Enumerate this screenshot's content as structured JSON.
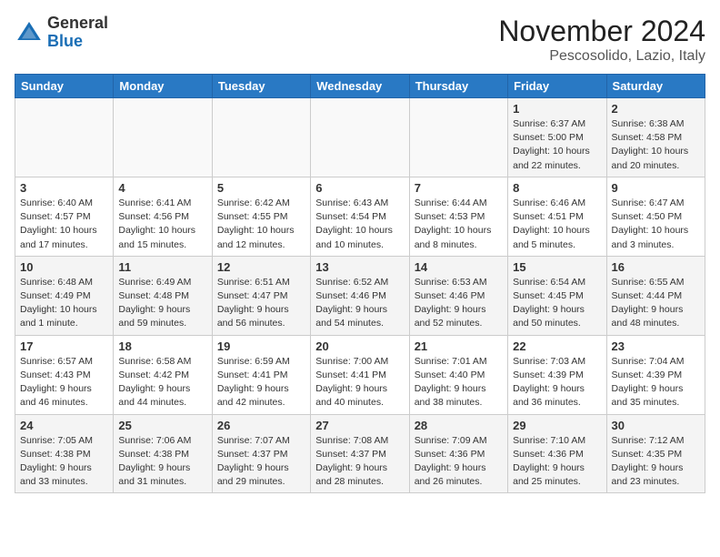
{
  "header": {
    "logo_general": "General",
    "logo_blue": "Blue",
    "month_title": "November 2024",
    "location": "Pescosolido, Lazio, Italy"
  },
  "weekdays": [
    "Sunday",
    "Monday",
    "Tuesday",
    "Wednesday",
    "Thursday",
    "Friday",
    "Saturday"
  ],
  "weeks": [
    [
      {
        "day": "",
        "info": ""
      },
      {
        "day": "",
        "info": ""
      },
      {
        "day": "",
        "info": ""
      },
      {
        "day": "",
        "info": ""
      },
      {
        "day": "",
        "info": ""
      },
      {
        "day": "1",
        "info": "Sunrise: 6:37 AM\nSunset: 5:00 PM\nDaylight: 10 hours and 22 minutes."
      },
      {
        "day": "2",
        "info": "Sunrise: 6:38 AM\nSunset: 4:58 PM\nDaylight: 10 hours and 20 minutes."
      }
    ],
    [
      {
        "day": "3",
        "info": "Sunrise: 6:40 AM\nSunset: 4:57 PM\nDaylight: 10 hours and 17 minutes."
      },
      {
        "day": "4",
        "info": "Sunrise: 6:41 AM\nSunset: 4:56 PM\nDaylight: 10 hours and 15 minutes."
      },
      {
        "day": "5",
        "info": "Sunrise: 6:42 AM\nSunset: 4:55 PM\nDaylight: 10 hours and 12 minutes."
      },
      {
        "day": "6",
        "info": "Sunrise: 6:43 AM\nSunset: 4:54 PM\nDaylight: 10 hours and 10 minutes."
      },
      {
        "day": "7",
        "info": "Sunrise: 6:44 AM\nSunset: 4:53 PM\nDaylight: 10 hours and 8 minutes."
      },
      {
        "day": "8",
        "info": "Sunrise: 6:46 AM\nSunset: 4:51 PM\nDaylight: 10 hours and 5 minutes."
      },
      {
        "day": "9",
        "info": "Sunrise: 6:47 AM\nSunset: 4:50 PM\nDaylight: 10 hours and 3 minutes."
      }
    ],
    [
      {
        "day": "10",
        "info": "Sunrise: 6:48 AM\nSunset: 4:49 PM\nDaylight: 10 hours and 1 minute."
      },
      {
        "day": "11",
        "info": "Sunrise: 6:49 AM\nSunset: 4:48 PM\nDaylight: 9 hours and 59 minutes."
      },
      {
        "day": "12",
        "info": "Sunrise: 6:51 AM\nSunset: 4:47 PM\nDaylight: 9 hours and 56 minutes."
      },
      {
        "day": "13",
        "info": "Sunrise: 6:52 AM\nSunset: 4:46 PM\nDaylight: 9 hours and 54 minutes."
      },
      {
        "day": "14",
        "info": "Sunrise: 6:53 AM\nSunset: 4:46 PM\nDaylight: 9 hours and 52 minutes."
      },
      {
        "day": "15",
        "info": "Sunrise: 6:54 AM\nSunset: 4:45 PM\nDaylight: 9 hours and 50 minutes."
      },
      {
        "day": "16",
        "info": "Sunrise: 6:55 AM\nSunset: 4:44 PM\nDaylight: 9 hours and 48 minutes."
      }
    ],
    [
      {
        "day": "17",
        "info": "Sunrise: 6:57 AM\nSunset: 4:43 PM\nDaylight: 9 hours and 46 minutes."
      },
      {
        "day": "18",
        "info": "Sunrise: 6:58 AM\nSunset: 4:42 PM\nDaylight: 9 hours and 44 minutes."
      },
      {
        "day": "19",
        "info": "Sunrise: 6:59 AM\nSunset: 4:41 PM\nDaylight: 9 hours and 42 minutes."
      },
      {
        "day": "20",
        "info": "Sunrise: 7:00 AM\nSunset: 4:41 PM\nDaylight: 9 hours and 40 minutes."
      },
      {
        "day": "21",
        "info": "Sunrise: 7:01 AM\nSunset: 4:40 PM\nDaylight: 9 hours and 38 minutes."
      },
      {
        "day": "22",
        "info": "Sunrise: 7:03 AM\nSunset: 4:39 PM\nDaylight: 9 hours and 36 minutes."
      },
      {
        "day": "23",
        "info": "Sunrise: 7:04 AM\nSunset: 4:39 PM\nDaylight: 9 hours and 35 minutes."
      }
    ],
    [
      {
        "day": "24",
        "info": "Sunrise: 7:05 AM\nSunset: 4:38 PM\nDaylight: 9 hours and 33 minutes."
      },
      {
        "day": "25",
        "info": "Sunrise: 7:06 AM\nSunset: 4:38 PM\nDaylight: 9 hours and 31 minutes."
      },
      {
        "day": "26",
        "info": "Sunrise: 7:07 AM\nSunset: 4:37 PM\nDaylight: 9 hours and 29 minutes."
      },
      {
        "day": "27",
        "info": "Sunrise: 7:08 AM\nSunset: 4:37 PM\nDaylight: 9 hours and 28 minutes."
      },
      {
        "day": "28",
        "info": "Sunrise: 7:09 AM\nSunset: 4:36 PM\nDaylight: 9 hours and 26 minutes."
      },
      {
        "day": "29",
        "info": "Sunrise: 7:10 AM\nSunset: 4:36 PM\nDaylight: 9 hours and 25 minutes."
      },
      {
        "day": "30",
        "info": "Sunrise: 7:12 AM\nSunset: 4:35 PM\nDaylight: 9 hours and 23 minutes."
      }
    ]
  ]
}
